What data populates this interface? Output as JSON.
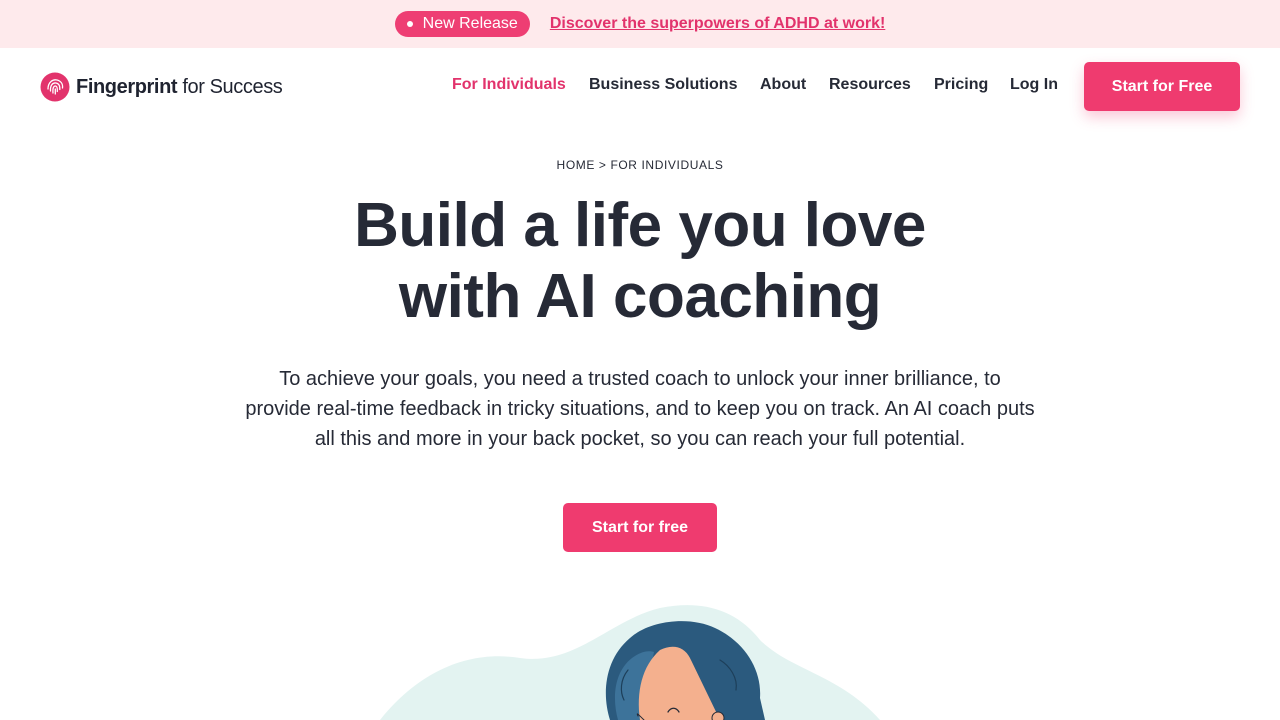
{
  "banner": {
    "badge_label": "New Release",
    "link_text": "Discover the superpowers of ADHD at work!"
  },
  "header": {
    "logo": {
      "name_bold": "Fingerprint",
      "name_light": " for Success"
    },
    "nav": [
      {
        "label": "For Individuals",
        "active": true
      },
      {
        "label": "Business Solutions",
        "active": false
      },
      {
        "label": "About",
        "active": false
      },
      {
        "label": "Resources",
        "active": false
      },
      {
        "label": "Pricing",
        "active": false
      },
      {
        "label": "Log In",
        "active": false
      }
    ],
    "cta_label": "Start for Free"
  },
  "hero": {
    "breadcrumb": {
      "home": "HOME",
      "separator": " > ",
      "current": "FOR INDIVIDUALS"
    },
    "headline_line1": "Build a life you love",
    "headline_line2": "with AI coaching",
    "subtext": "To achieve your goals, you need a trusted coach to unlock your inner brilliance, to provide real-time feedback in tricky situations, and to keep you on track. An AI coach puts all this and more in your back pocket, so you can reach your full potential.",
    "cta_label": "Start for free"
  },
  "colors": {
    "brand": "#ef3b6f",
    "banner_bg": "#feeaec",
    "text": "#262a36",
    "illustration_bg": "#e3f3f1",
    "hair": "#2b5a7e",
    "skin": "#f4b08e"
  }
}
